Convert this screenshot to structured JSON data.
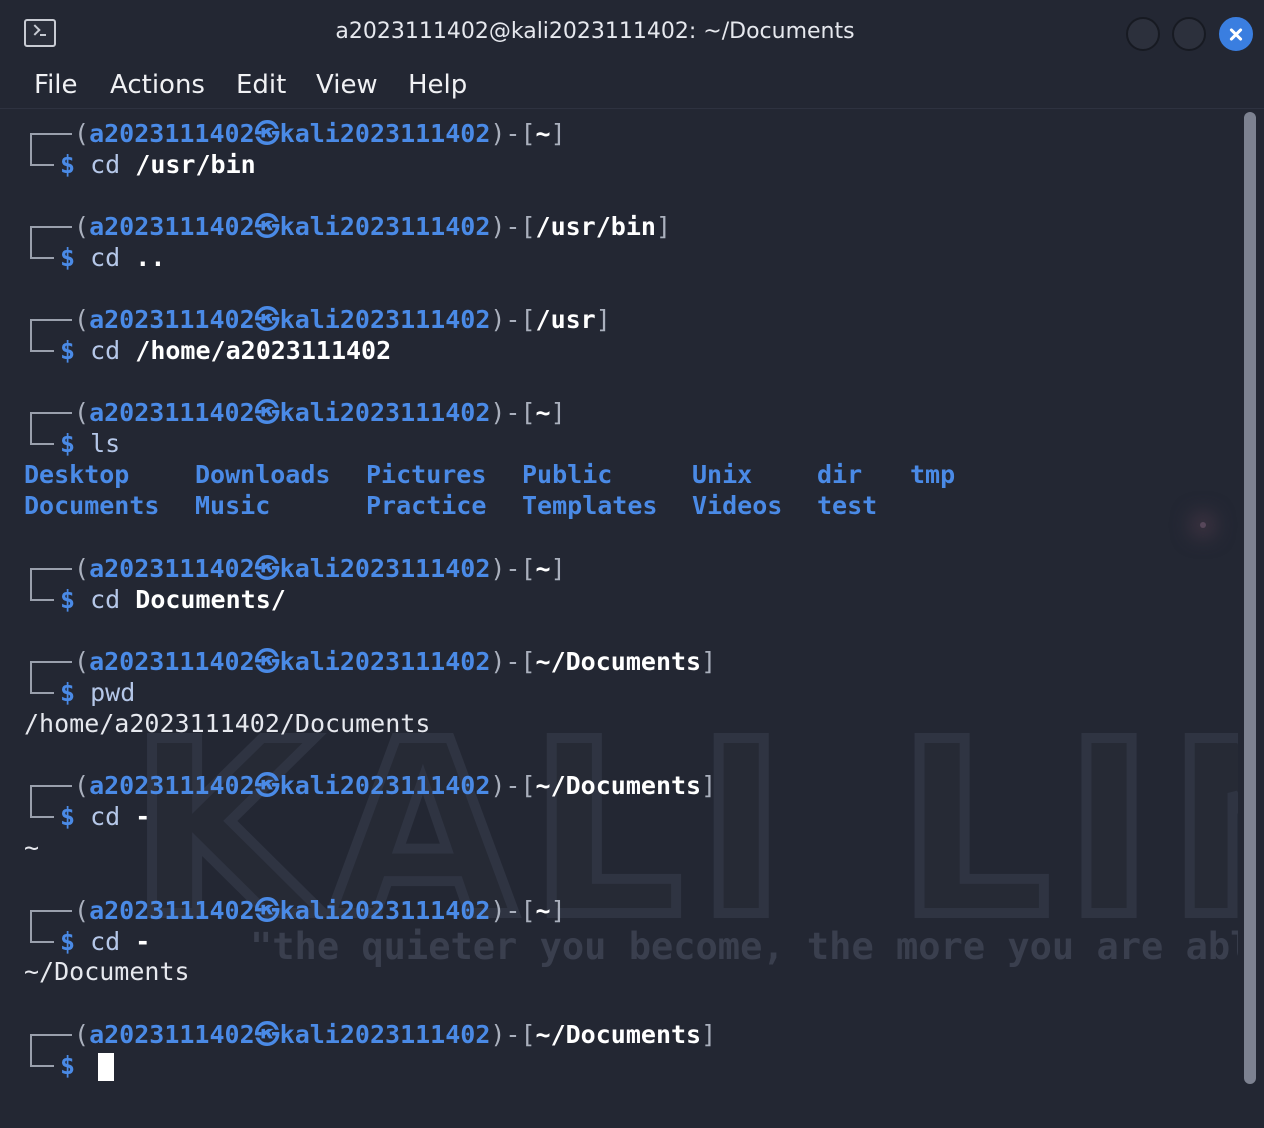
{
  "window": {
    "title": "a2023111402@kali2023111402: ~/Documents"
  },
  "menu": [
    "File",
    "Actions",
    "Edit",
    "View",
    "Help"
  ],
  "prompt": {
    "user": "a2023111402",
    "at_symbol": "㉿",
    "host": "kali2023111402",
    "open": "(",
    "close": ")-[",
    "end": "]",
    "dollar": "$"
  },
  "blocks": [
    {
      "path": "~",
      "cmd": "cd",
      "arg": "/usr/bin"
    },
    {
      "path": "/usr/bin",
      "cmd": "cd",
      "arg": ".."
    },
    {
      "path": "/usr",
      "cmd": "cd",
      "arg": "/home/a2023111402"
    },
    {
      "path": "~",
      "cmd": "ls",
      "arg": ""
    },
    {
      "path": "~",
      "cmd": "cd",
      "arg": "Documents/"
    },
    {
      "path": "~/Documents",
      "cmd": "pwd",
      "arg": ""
    },
    {
      "path": "~/Documents",
      "cmd": "cd",
      "arg": "-"
    },
    {
      "path": "~",
      "cmd": "cd",
      "arg": "-"
    },
    {
      "path": "~/Documents",
      "cmd": "",
      "arg": ""
    }
  ],
  "ls_output": {
    "row1": [
      "Desktop",
      "Downloads",
      "Pictures",
      "Public",
      "Unix",
      "dir",
      "tmp"
    ],
    "row2": [
      "Documents",
      "Music",
      "Practice",
      "Templates",
      "Videos",
      "test"
    ]
  },
  "outputs": {
    "pwd": "/home/a2023111402/Documents",
    "cd_dash_1": "~",
    "cd_dash_2": "~/Documents"
  },
  "wallpaper": {
    "logo": "KALI LINUX",
    "tagline": "\"the quieter you become, the more you are able to h"
  },
  "colors": {
    "background": "#232733",
    "prompt_blue": "#4a8ae6",
    "close_button": "#3a7ee0"
  }
}
